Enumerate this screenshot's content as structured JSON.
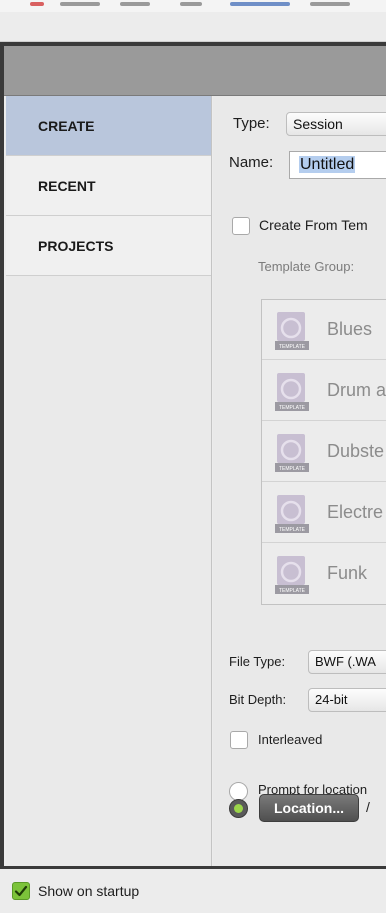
{
  "sidebar": {
    "items": [
      {
        "label": "CREATE",
        "active": true
      },
      {
        "label": "RECENT",
        "active": false
      },
      {
        "label": "PROJECTS",
        "active": false
      }
    ]
  },
  "create": {
    "type_label": "Type:",
    "type_value": "Session",
    "name_label": "Name:",
    "name_value": "Untitled",
    "create_from_template_label": "Create From Tem",
    "template_group_label": "Template Group:",
    "templates": [
      {
        "name": "Blues",
        "badge": "TEMPLATE"
      },
      {
        "name": "Drum a",
        "badge": "TEMPLATE"
      },
      {
        "name": "Dubste",
        "badge": "TEMPLATE"
      },
      {
        "name": "Electre",
        "badge": "TEMPLATE"
      },
      {
        "name": "Funk",
        "badge": "TEMPLATE"
      }
    ],
    "file_type_label": "File Type:",
    "file_type_value": "BWF (.WA",
    "bit_depth_label": "Bit Depth:",
    "bit_depth_value": "24-bit",
    "interleaved_label": "Interleaved",
    "prompt_location_label": "Prompt for location",
    "location_button": "Location...",
    "location_path": "/"
  },
  "footer": {
    "show_on_startup_label": "Show on startup",
    "show_on_startup_checked": true
  },
  "colors": {
    "sidebar_active": "#b9c6dc",
    "header_band": "#9a9a9a",
    "radio_selected": "#9bd54a",
    "checkbox_checked": "#7cc33a"
  }
}
